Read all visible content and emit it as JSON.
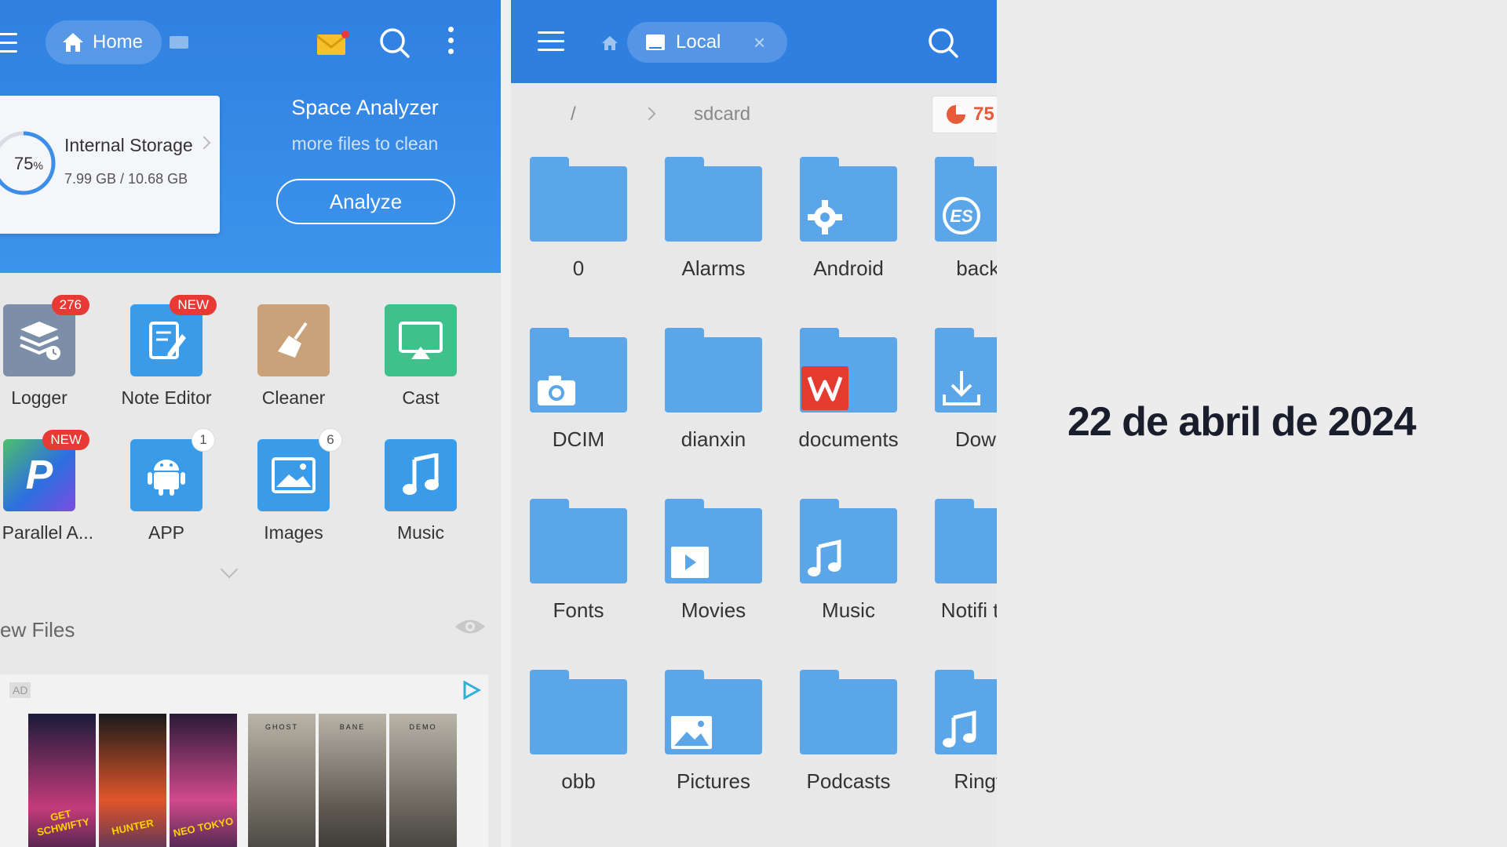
{
  "left": {
    "header": {
      "home_label": "Home"
    },
    "storage": {
      "percent": "75",
      "percent_unit": "%",
      "title": "Internal Storage",
      "size": "7.99 GB / 10.68 GB"
    },
    "space_analyzer": {
      "title": "Space Analyzer",
      "subtitle": "more files to clean",
      "button": "Analyze"
    },
    "apps": [
      {
        "label": "Logger",
        "badge": "276",
        "icon": "logger-icon",
        "color": "#7d8fa8"
      },
      {
        "label": "Note Editor",
        "badge": "NEW",
        "icon": "note-editor-icon",
        "color": "#3a9be8"
      },
      {
        "label": "Cleaner",
        "badge": "",
        "icon": "broom-icon",
        "color": "#c9a27a"
      },
      {
        "label": "Cast",
        "badge": "",
        "icon": "cast-icon",
        "color": "#3cc28a"
      },
      {
        "label": "S Parallel A...",
        "badge": "NEW",
        "icon": "parallel-icon",
        "color": "#2d6fe0"
      },
      {
        "label": "APP",
        "badge": "1",
        "icon": "android-icon",
        "color": "#3a9be8"
      },
      {
        "label": "Images",
        "badge": "6",
        "icon": "image-icon",
        "color": "#3a9be8"
      },
      {
        "label": "Music",
        "badge": "",
        "icon": "music-icon",
        "color": "#3a9be8"
      }
    ],
    "new_files_label": "ew Files",
    "ad": {
      "tag": "AD",
      "posters": [
        "GET SCHWIFTY",
        "HUNTER",
        "NEO TOKYO",
        "GHOST",
        "BANE",
        "DEMO"
      ]
    }
  },
  "right": {
    "header": {
      "local_label": "Local",
      "close": "×"
    },
    "path": {
      "root": "/",
      "current": "sdcard"
    },
    "usage": "75",
    "folders": [
      {
        "label": "0",
        "glyph": ""
      },
      {
        "label": "Alarms",
        "glyph": ""
      },
      {
        "label": "Android",
        "glyph": "gear-icon"
      },
      {
        "label": "backu",
        "glyph": "es-icon"
      },
      {
        "label": "DCIM",
        "glyph": "camera-icon"
      },
      {
        "label": "dianxin",
        "glyph": ""
      },
      {
        "label": "documents",
        "glyph": "wps-icon"
      },
      {
        "label": "Downl",
        "glyph": "download-icon"
      },
      {
        "label": "Fonts",
        "glyph": ""
      },
      {
        "label": "Movies",
        "glyph": "play-icon"
      },
      {
        "label": "Music",
        "glyph": "music-note-icon"
      },
      {
        "label": "Notifi tion",
        "glyph": ""
      },
      {
        "label": "obb",
        "glyph": ""
      },
      {
        "label": "Pictures",
        "glyph": "picture-icon"
      },
      {
        "label": "Podcasts",
        "glyph": ""
      },
      {
        "label": "Ringto",
        "glyph": "music-note-icon"
      }
    ]
  },
  "date": "22 de abril de 2024",
  "colors": {
    "header_blue": "#2f7fe0",
    "folder_blue": "#5ba6e8",
    "badge_red": "#e83a35",
    "usage_orange": "#e85a3a"
  }
}
